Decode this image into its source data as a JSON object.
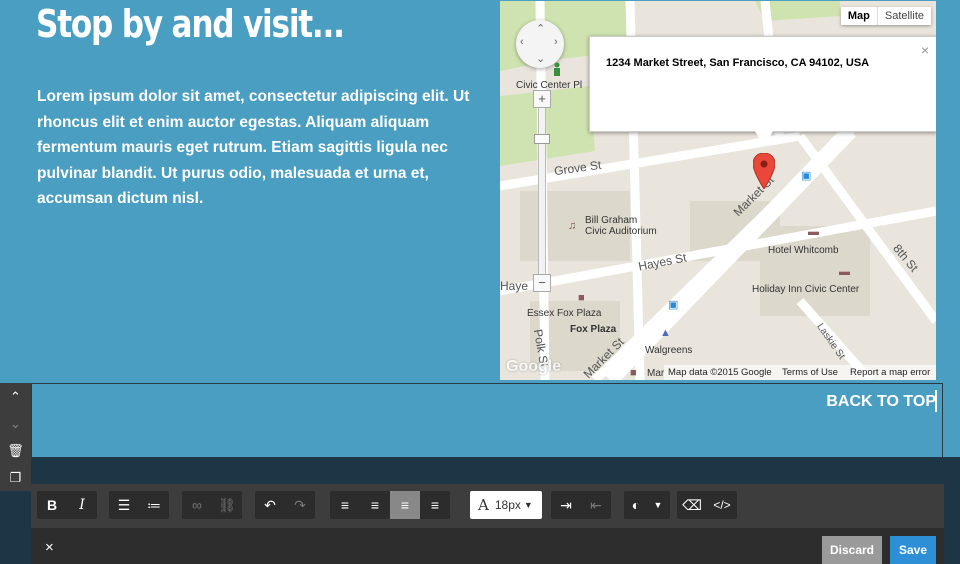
{
  "section": {
    "heading": "Stop by and visit...",
    "paragraph": "Lorem ipsum dolor sit amet, consectetur adipiscing elit. Ut rhoncus elit et enim auctor egestas. Aliquam aliquam fermentum mauris eget rutrum. Etiam sagittis ligula nec pulvinar blandit. Ut purus odio, malesuada et urna et, accumsan dictum nisl."
  },
  "map": {
    "type_map": "Map",
    "type_satellite": "Satellite",
    "info_address": "1234 Market Street, San Francisco, CA 94102, USA",
    "info_close": "×",
    "zoom_in": "+",
    "zoom_out": "−",
    "labels": {
      "civic_center": "Civic Center Pl",
      "grove": "Grove St",
      "bill_graham_1": "Bill Graham",
      "bill_graham_2": "Civic Auditorium",
      "hayes_1": "Hayes St",
      "hayes_2": "Haye",
      "market": "Market St",
      "market_2": "Market St",
      "hotel_whitcomb": "Hotel Whitcomb",
      "holiday_inn": "Holiday Inn Civic Center",
      "eighth": "8th St",
      "essex": "Essex Fox Plaza",
      "fox_plaza": "Fox Plaza",
      "walgreens": "Walgreens",
      "polk": "Polk St",
      "laskie": "Laskie St",
      "mar": "Mar",
      "google": "Google"
    },
    "footer_data": "Map data ©2015 Google",
    "footer_terms": "Terms of Use",
    "footer_report": "Report a map error"
  },
  "editor": {
    "back_to_top": "BACK TO TOP",
    "font_size": "18px",
    "discard_label": "Discard",
    "save_label": "Save",
    "close_label": "×"
  },
  "colors": {
    "background": "#4a9ec2",
    "editor_band": "#1d3545",
    "save_button": "#2d8fd6",
    "discard_button": "#9a9a9a"
  }
}
